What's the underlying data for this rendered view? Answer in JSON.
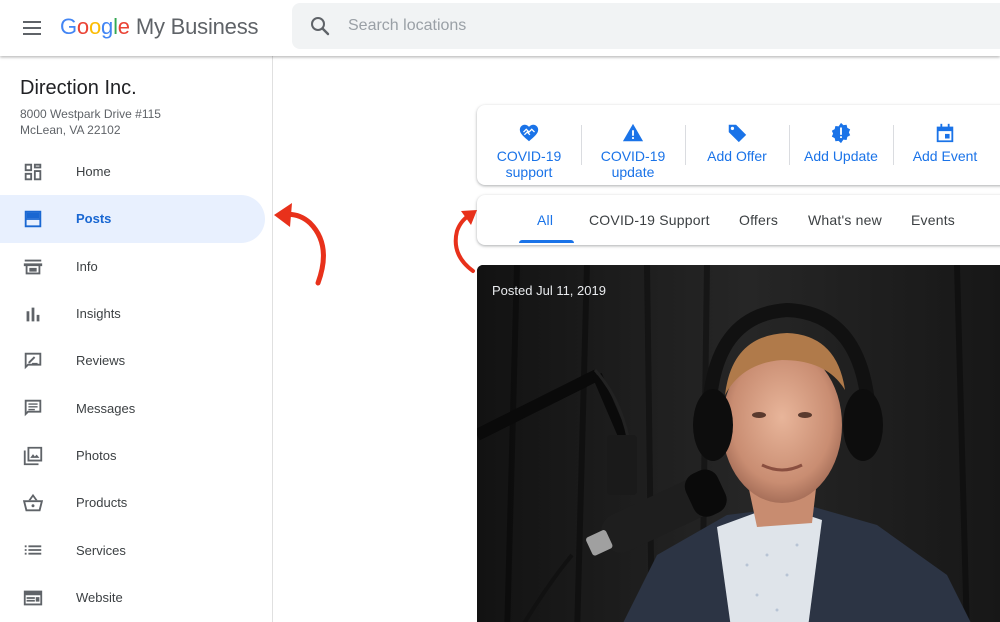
{
  "header": {
    "menu_icon": "hamburger-menu-icon",
    "brand_letters": [
      "G",
      "o",
      "o",
      "g",
      "l",
      "e"
    ],
    "product": "My Business",
    "search_placeholder": "Search locations"
  },
  "business": {
    "name": "Direction Inc.",
    "address_line1": "8000 Westpark Drive #115",
    "address_line2": "McLean, VA 22102"
  },
  "sidebar": {
    "items": [
      {
        "label": "Home",
        "icon": "dashboard-icon",
        "active": false
      },
      {
        "label": "Posts",
        "icon": "posts-icon",
        "active": true
      },
      {
        "label": "Info",
        "icon": "storefront-icon",
        "active": false
      },
      {
        "label": "Insights",
        "icon": "bar-chart-icon",
        "active": false
      },
      {
        "label": "Reviews",
        "icon": "rate-review-icon",
        "active": false
      },
      {
        "label": "Messages",
        "icon": "message-icon",
        "active": false
      },
      {
        "label": "Photos",
        "icon": "photo-library-icon",
        "active": false
      },
      {
        "label": "Products",
        "icon": "shopping-basket-icon",
        "active": false
      },
      {
        "label": "Services",
        "icon": "list-icon",
        "active": false
      },
      {
        "label": "Website",
        "icon": "web-icon",
        "active": false
      }
    ]
  },
  "actions": [
    {
      "label_line1": "COVID-19",
      "label_line2": "support",
      "icon": "heart-hands-icon"
    },
    {
      "label_line1": "COVID-19",
      "label_line2": "update",
      "icon": "warning-icon"
    },
    {
      "label_line1": "Add Offer",
      "label_line2": "",
      "icon": "tag-icon"
    },
    {
      "label_line1": "Add Update",
      "label_line2": "",
      "icon": "announcement-badge-icon"
    },
    {
      "label_line1": "Add Event",
      "label_line2": "",
      "icon": "calendar-event-icon"
    }
  ],
  "tabs": [
    {
      "label": "All",
      "active": true
    },
    {
      "label": "COVID-19 Support",
      "active": false
    },
    {
      "label": "Offers",
      "active": false
    },
    {
      "label": "What's new",
      "active": false
    },
    {
      "label": "Events",
      "active": false
    }
  ],
  "post": {
    "date_label": "Posted Jul 11, 2019",
    "image": "man-with-headphones-at-microphone-photo"
  },
  "colors": {
    "accent_blue": "#1a73e8",
    "active_bg": "#e8f0fe",
    "annotation_red": "#e8311b"
  }
}
